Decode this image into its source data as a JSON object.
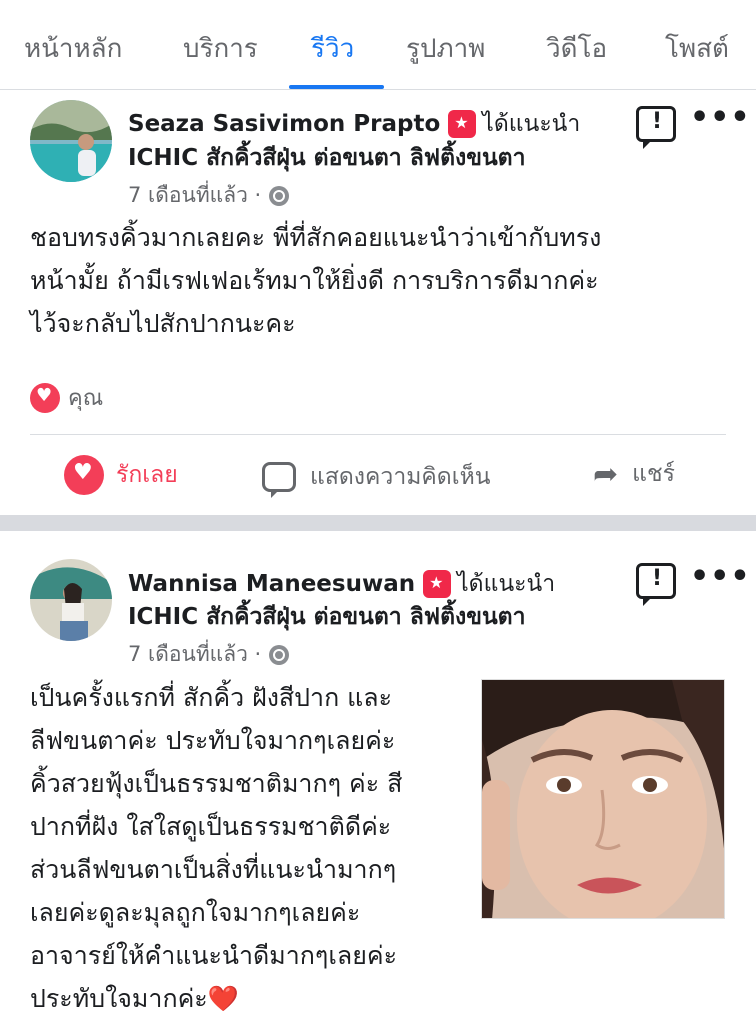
{
  "tabs": [
    {
      "label": "หน้าหลัก",
      "active": false
    },
    {
      "label": "บริการ",
      "active": false
    },
    {
      "label": "รีวิว",
      "active": true
    },
    {
      "label": "รูปภาพ",
      "active": false
    },
    {
      "label": "วิดีโอ",
      "active": false
    },
    {
      "label": "โพสต์",
      "active": false
    }
  ],
  "colors": {
    "accent": "#1877f2",
    "love": "#f33e58",
    "muted": "#65676b"
  },
  "posts": [
    {
      "author": "Seaza Sasivimon Prapto",
      "recommend_text": "ได้แนะนำ",
      "page_name": "ICHIC สักคิ้วสีฝุ่น ต่อขนตา ลิฟติ้งขนตา",
      "time": "7 เดือนที่แล้ว ·",
      "body": [
        "ชอบทรงคิ้วมากเลยคะ พี่ที่สักคอยแนะนำว่าเข้ากับทรง",
        "หน้ามั้ย ถ้ามีเรฟเฟอเร้ทมาให้ยิ่งดี การบริการดีมากค่ะ",
        "ไว้จะกลับไปสักปากนะคะ"
      ],
      "reaction_by": "คุณ",
      "actions": {
        "love": "รักเลย",
        "comment": "แสดงความคิดเห็น",
        "share": "แชร์"
      }
    },
    {
      "author": "Wannisa Maneesuwan",
      "recommend_text": "ได้แนะนำ",
      "page_name": "ICHIC สักคิ้วสีฝุ่น ต่อขนตา ลิฟติ้งขนตา",
      "time": "7 เดือนที่แล้ว ·",
      "body": [
        "เป็นครั้งแรกที่ สักคิ้ว ฝังสีปาก และ",
        "ลีฟขนตาค่ะ ประทับใจมากๆเลยค่ะ",
        "คิ้วสวยฟุ้งเป็นธรรมชาติมากๆ ค่ะ สี",
        "ปากที่ฝัง ใสใสดูเป็นธรรมชาติดีค่ะ",
        "ส่วนลีฟขนตาเป็นสิ่งที่แนะนำมากๆ",
        "เลยค่ะดูละมุลถูกใจมากๆเลยค่ะ",
        "อาจารย์ให้คำแนะนำดีมากๆเลยค่ะ",
        "ประทับใจมากค่ะ❤️"
      ]
    }
  ]
}
